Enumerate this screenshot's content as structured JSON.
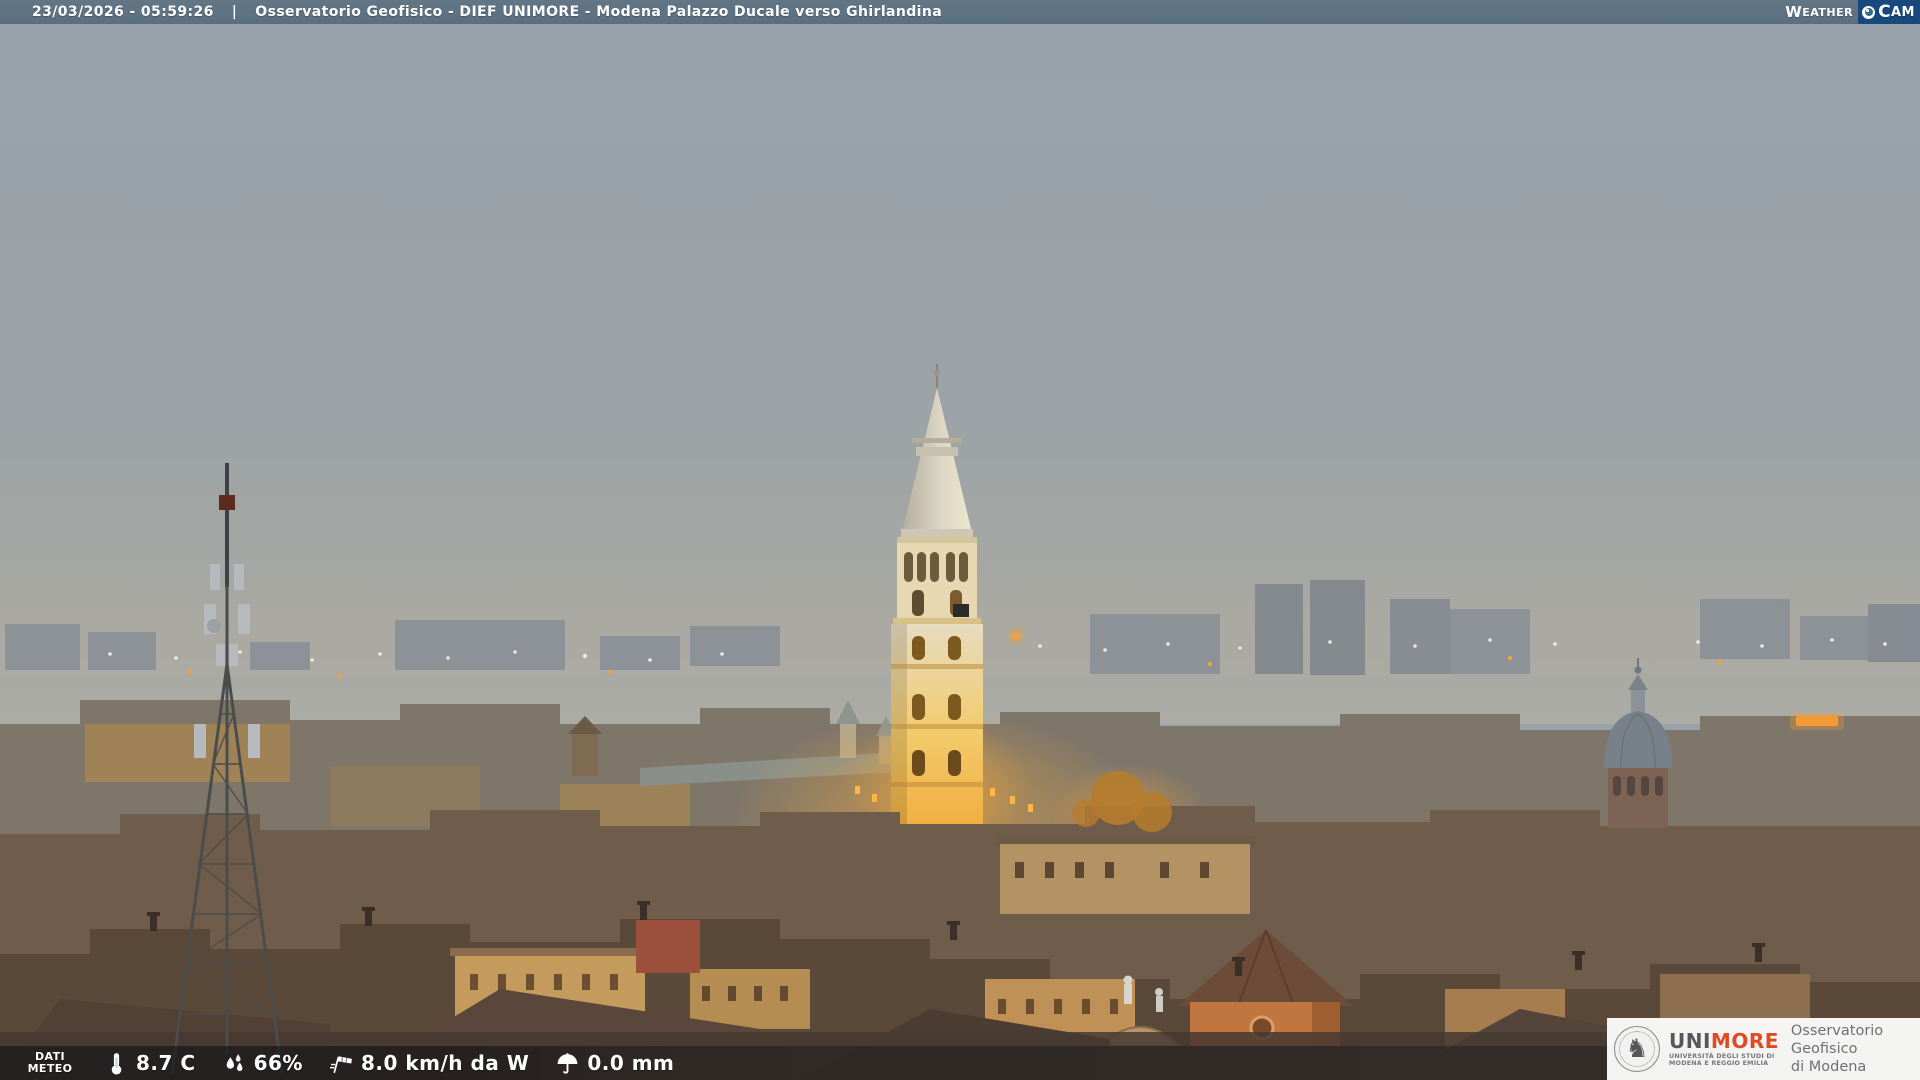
{
  "header": {
    "timestamp": "23/03/2026 - 05:59:26",
    "separator": "|",
    "title": "Osservatorio Geofisico - DIEF UNIMORE - Modena Palazzo Ducale verso Ghirlandina",
    "weathercam": {
      "w_initial": "W",
      "w_rest": "EATHER",
      "c_initial": "C",
      "c_rest": "AM"
    }
  },
  "weather_bar": {
    "label_line1": "DATI",
    "label_line2": "METEO",
    "readings": {
      "temperature": {
        "icon": "thermometer-icon",
        "value": "8.7 C"
      },
      "humidity": {
        "icon": "humidity-drops-icon",
        "value": "66%"
      },
      "wind": {
        "icon": "windsock-icon",
        "value": "8.0 km/h da W"
      },
      "precipitation": {
        "icon": "umbrella-icon",
        "value": "0.0 mm"
      }
    }
  },
  "branding": {
    "brand_uni": "UNI",
    "brand_more": "MORE",
    "university_line1": "UNIVERSITÀ DEGLI STUDI DI",
    "university_line2": "MODENA E REGGIO EMILIA",
    "org_line1": "Osservatorio Geofisico",
    "org_line2": "di Modena",
    "seal_glyph": "♞"
  },
  "colors": {
    "header_bg": "#5d7181",
    "weathercam_blue": "#17497c",
    "unimore_red": "#e04a23",
    "tower_glow": "#f2a93b",
    "sky_top": "#99a2ab",
    "sky_horizon": "#abaca5"
  }
}
